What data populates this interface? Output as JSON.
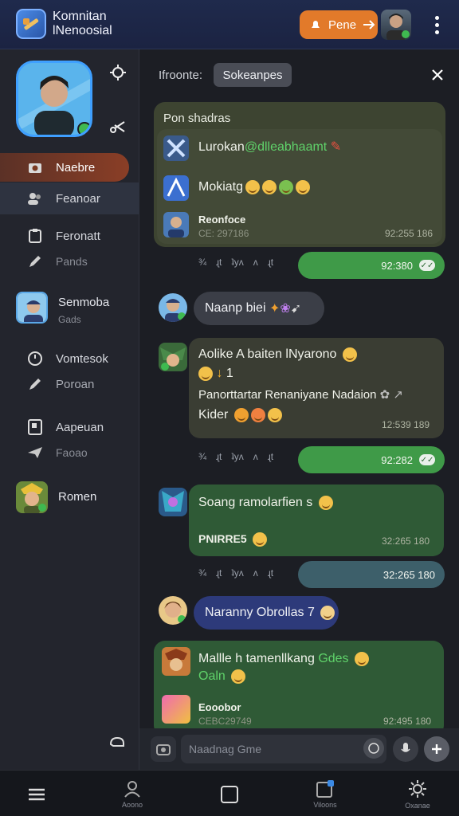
{
  "header": {
    "app_title_line1": "Komnitan",
    "app_title_line2": "lNenoosial",
    "action_label": "Pene",
    "action_icon": "send-icon"
  },
  "sidebar": {
    "nav": [
      {
        "label": "Naebre",
        "icon": "camera-icon"
      },
      {
        "label": "Feanoar",
        "icon": "users-icon"
      },
      {
        "label": "Feronatt",
        "icon": "clipboard-icon"
      },
      {
        "label": "Pands",
        "icon": "pencil-icon"
      },
      {
        "label": "Senmoba",
        "sub": "Gads"
      },
      {
        "label": "Vomtesok",
        "icon": "clock-icon"
      },
      {
        "label": "Poroan",
        "icon": "pencil-icon"
      },
      {
        "label": "Aapeuan",
        "icon": "doc-icon"
      },
      {
        "label": "Faoao",
        "icon": "plane-icon"
      },
      {
        "label": "Romen"
      }
    ]
  },
  "chat_header": {
    "label": "Ifroonte:",
    "chip": "Sokeanpes"
  },
  "messages": {
    "card1": {
      "title": "Pon shadras",
      "row1": "Lurokan",
      "row1_green": "@dlleabhaamt",
      "row2": "Mokiatg",
      "row3_title": "Reonfoce",
      "row3_meta": "CE: 297186",
      "row3_time": "92:255 186",
      "out_time": "92:380"
    },
    "bubble2": "Naanp biei",
    "card3": {
      "line1": "Aolike A baiten lNyarono",
      "line2": "1",
      "line3": "Panorttartar Renaniyane Nadaion",
      "line4": "Kider",
      "time": "12:539 189",
      "out_time": "92:282"
    },
    "card4": {
      "line1": "Soang ramolarfien s",
      "line2": "PNIRRE5",
      "time": "32:265 180",
      "out_time": "32:265 180"
    },
    "bubble5": "Naranny Obrollas 7",
    "card6": {
      "line1": "Mallle h tamenllkang",
      "line1_green": "Gdes",
      "line2": "Oaln",
      "row_title": "Eooobor",
      "row_meta": "CEBC29749",
      "row_time": "92:495 180"
    },
    "reactions": [
      "¾",
      "ɻt",
      "ʌ",
      "ʇyʌ"
    ]
  },
  "composer": {
    "placeholder": "Naadnag Gme"
  },
  "bottom_nav": [
    {
      "label": "",
      "icon": "menu-icon"
    },
    {
      "label": "Aoono",
      "icon": "person-icon"
    },
    {
      "label": "",
      "icon": "square-icon"
    },
    {
      "label": "Viloons",
      "icon": "notes-icon"
    },
    {
      "label": "Oxanae",
      "icon": "gear-icon"
    }
  ]
}
